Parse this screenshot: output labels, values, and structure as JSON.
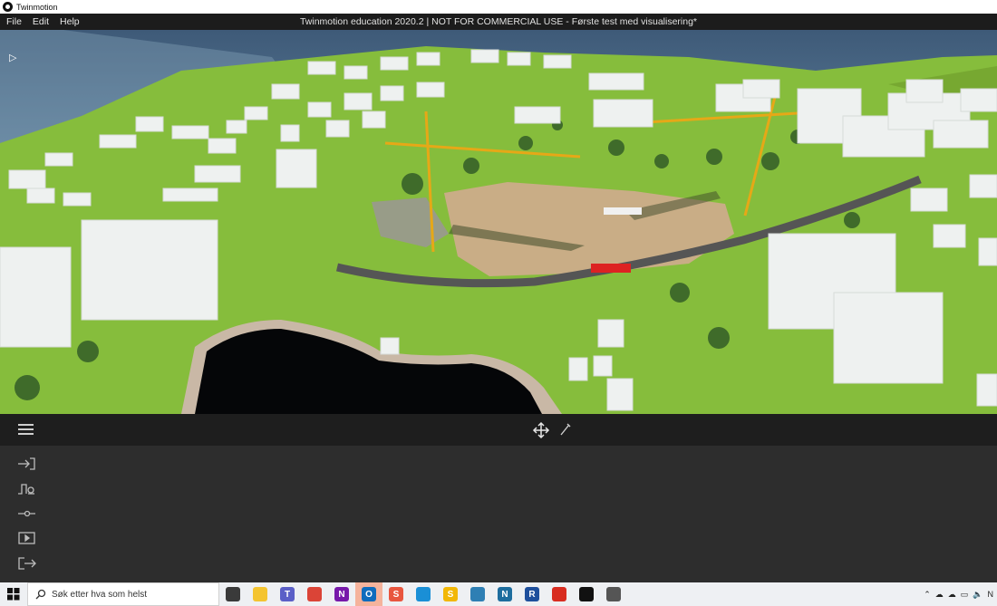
{
  "titlebar": {
    "app_name": "Twinmotion"
  },
  "menu": {
    "items": [
      "File",
      "Edit",
      "Help"
    ],
    "document_title": "Twinmotion education 2020.2 | NOT FOR COMMERCIAL USE - Første test med visualisering*"
  },
  "viewport": {
    "play_icon": "play-arrow-icon",
    "scene": "construction-site-3d-scene"
  },
  "dock": {
    "menu_icon": "hamburger-icon",
    "tools": [
      {
        "name": "move-tool",
        "icon": "move-arrows-icon"
      },
      {
        "name": "pick-tool",
        "icon": "eyedropper-icon"
      }
    ],
    "side_icons": [
      "import-icon",
      "context-icon",
      "settings-icon",
      "media-icon",
      "export-icon"
    ]
  },
  "taskbar": {
    "search_placeholder": "Søk etter hva som helst",
    "apps": [
      {
        "name": "task-view",
        "label": "",
        "color": "#3a3a3a"
      },
      {
        "name": "file-explorer",
        "label": "",
        "color": "#f4c430"
      },
      {
        "name": "teams",
        "label": "T",
        "color": "#5b5fc7"
      },
      {
        "name": "chrome",
        "label": "",
        "color": "#db4437"
      },
      {
        "name": "onenote",
        "label": "N",
        "color": "#7719aa"
      },
      {
        "name": "outlook",
        "label": "O",
        "color": "#0f6cbd"
      },
      {
        "name": "sketch-app",
        "label": "S",
        "color": "#e8563f"
      },
      {
        "name": "edge",
        "label": "",
        "color": "#1a8fd6"
      },
      {
        "name": "s-app",
        "label": "S",
        "color": "#f2b705"
      },
      {
        "name": "home-app",
        "label": "",
        "color": "#2e7fb4"
      },
      {
        "name": "navisworks",
        "label": "N",
        "color": "#1d6d9e"
      },
      {
        "name": "revit",
        "label": "R",
        "color": "#1e4f9c"
      },
      {
        "name": "shield-app",
        "label": "",
        "color": "#d82c20"
      },
      {
        "name": "twinmotion",
        "label": "",
        "color": "#111111"
      },
      {
        "name": "settings",
        "label": "",
        "color": "#555555"
      }
    ],
    "tray_right": "N"
  }
}
